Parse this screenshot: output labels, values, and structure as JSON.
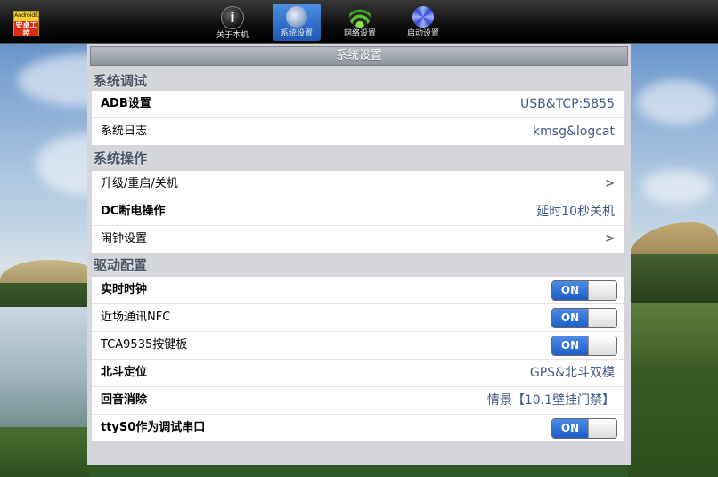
{
  "topbar": {
    "logo_line1": "AndroidEx",
    "logo_line2": "安卓工控",
    "tabs": [
      {
        "label": "关于本机",
        "icon": "info-icon",
        "active": false
      },
      {
        "label": "系统设置",
        "icon": "system-settings-icon",
        "active": true
      },
      {
        "label": "网络设置",
        "icon": "wifi-icon",
        "active": false
      },
      {
        "label": "启动设置",
        "icon": "boot-icon",
        "active": false
      }
    ]
  },
  "panel": {
    "title": "系统设置",
    "sections": [
      {
        "title": "系统调试",
        "rows": [
          {
            "label": "ADB设置",
            "value": "USB&TCP:5855"
          },
          {
            "label": "系统日志",
            "value": "kmsg&logcat"
          }
        ]
      },
      {
        "title": "系统操作",
        "rows": [
          {
            "label": "升级/重启/关机",
            "chevron": ">"
          },
          {
            "label": "DC断电操作",
            "value": "延时10秒关机"
          },
          {
            "label": "闹钟设置",
            "chevron": ">"
          }
        ]
      },
      {
        "title": "驱动配置",
        "rows": [
          {
            "label": "实时时钟",
            "toggle": "ON"
          },
          {
            "label": "近场通讯NFC",
            "toggle": "ON"
          },
          {
            "label": "TCA9535按键板",
            "toggle": "ON"
          },
          {
            "label": "北斗定位",
            "value": "GPS&北斗双模"
          },
          {
            "label": "回音消除",
            "value": "情景【10.1壁挂门禁】"
          },
          {
            "label": "ttyS0作为调试串口",
            "toggle": "ON"
          }
        ]
      }
    ]
  },
  "colors": {
    "accent": "#1e5cc8",
    "value_text": "#3f5b8a",
    "section_text": "#4a5566"
  }
}
